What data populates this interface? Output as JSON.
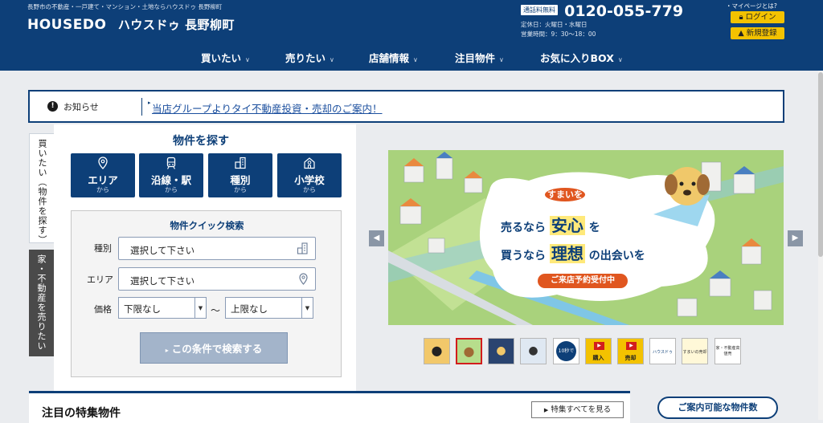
{
  "header": {
    "tagline": "長野市の不動産・一戸建て・マンション・土地ならハウスドゥ 長野柳町",
    "logo_en": "HOUSEDO",
    "logo_jp": "ハウスドゥ 長野柳町",
    "tel_badge": "通話料無料",
    "tel": "0120-055-779",
    "closed_days": "定休日：火曜日・水曜日",
    "hours": "営業時間：9：30～18：00",
    "mypage_link": "・マイページとは?",
    "login": "ログイン",
    "register": "新規登録",
    "nav": [
      "買いたい",
      "売りたい",
      "店舗情報",
      "注目物件",
      "お気に入りBOX"
    ]
  },
  "notice": {
    "label": "お知らせ",
    "link": "当店グループよりタイ不動産投資・売却のご案内！"
  },
  "side_tabs": {
    "buy": "買いたい（物件を探す）",
    "sell": "家・不動産を売りたい"
  },
  "search": {
    "title": "物件を探す",
    "categories": [
      {
        "name": "エリア",
        "sub": "から",
        "icon": "map-pin-icon"
      },
      {
        "name": "沿線・駅",
        "sub": "から",
        "icon": "train-icon"
      },
      {
        "name": "種別",
        "sub": "から",
        "icon": "building-icon"
      },
      {
        "name": "小学校",
        "sub": "から",
        "icon": "school-icon"
      }
    ],
    "quick": {
      "title": "物件クイック検索",
      "type_label": "種別",
      "type_value": "選択して下さい",
      "area_label": "エリア",
      "area_value": "選択して下さい",
      "price_label": "価格",
      "price_min": "下限なし",
      "price_max": "上限なし",
      "tilde": "～",
      "submit": "この条件で検索する"
    }
  },
  "banner": {
    "line0": "すまいを",
    "line1a": "売るなら",
    "line1b": "安心",
    "line1c": "を",
    "line2a": "買うなら",
    "line2b": "理想",
    "line2c": "の出会いを",
    "cta": "ご来店予約受付中",
    "thumbs": [
      {
        "label": ""
      },
      {
        "label": ""
      },
      {
        "label": ""
      },
      {
        "label": ""
      },
      {
        "label": "10秒で"
      },
      {
        "label": "購入"
      },
      {
        "label": "売却"
      },
      {
        "label": "ハウスドゥ"
      },
      {
        "label": "すまいの売却"
      },
      {
        "label": "家・不動産高値売"
      }
    ]
  },
  "featured": {
    "title": "注目の特集物件",
    "view_all": "特集すべてを見る",
    "available": "ご案内可能な物件数"
  },
  "colors": {
    "brand": "#0d3f78",
    "accent": "#f3c200",
    "thumb_selected": "#d21d1d"
  }
}
